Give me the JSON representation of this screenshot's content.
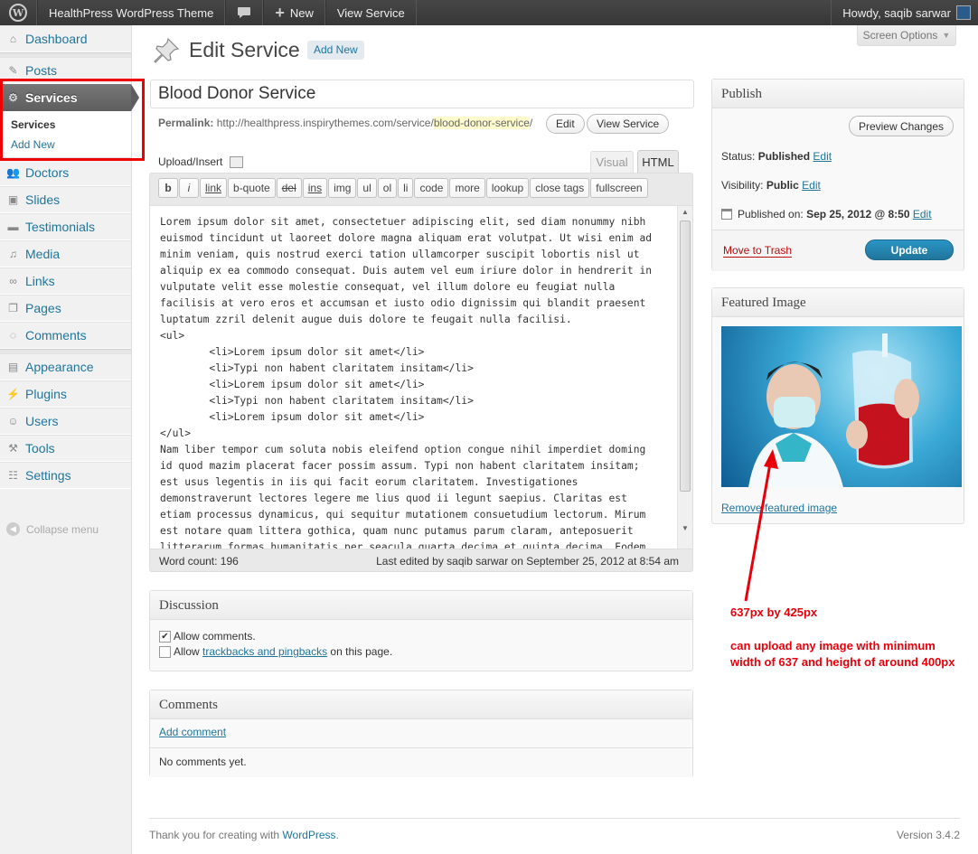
{
  "admin_bar": {
    "site_name": "HealthPress WordPress Theme",
    "comments_icon": "speech-bubble-icon",
    "new_label": "New",
    "view_label": "View Service",
    "howdy": "Howdy, saqib sarwar"
  },
  "sidebar": {
    "items": [
      {
        "label": "Dashboard",
        "icon": "dashboard-icon"
      },
      {
        "label": "Posts",
        "icon": "pin-icon"
      },
      {
        "label": "Services",
        "icon": "gear-icon"
      },
      {
        "label": "Doctors",
        "icon": "users-icon"
      },
      {
        "label": "Slides",
        "icon": "image-icon"
      },
      {
        "label": "Testimonials",
        "icon": "comment-icon"
      },
      {
        "label": "Media",
        "icon": "media-icon"
      },
      {
        "label": "Links",
        "icon": "link-icon"
      },
      {
        "label": "Pages",
        "icon": "pages-icon"
      },
      {
        "label": "Comments",
        "icon": "comments-icon"
      },
      {
        "label": "Appearance",
        "icon": "appearance-icon"
      },
      {
        "label": "Plugins",
        "icon": "plugin-icon"
      },
      {
        "label": "Users",
        "icon": "users-icon"
      },
      {
        "label": "Tools",
        "icon": "tools-icon"
      },
      {
        "label": "Settings",
        "icon": "settings-icon"
      }
    ],
    "submenu": [
      "Services",
      "Add New"
    ],
    "collapse": "Collapse menu"
  },
  "header": {
    "title": "Edit Service",
    "add_new": "Add New",
    "screen_options": "Screen Options"
  },
  "post": {
    "title": "Blood Donor Service",
    "permalink_label": "Permalink:",
    "permalink_base": "http://healthpress.inspirythemes.com/service/",
    "permalink_slug": "blood-donor-service",
    "permalink_end": "/",
    "edit_btn": "Edit",
    "view_btn": "View Service"
  },
  "editor": {
    "upload_label": "Upload/Insert",
    "tab_visual": "Visual",
    "tab_html": "HTML",
    "quicktags": [
      "b",
      "i",
      "link",
      "b-quote",
      "del",
      "ins",
      "img",
      "ul",
      "ol",
      "li",
      "code",
      "more",
      "lookup",
      "close tags",
      "fullscreen"
    ],
    "content": "Lorem ipsum dolor sit amet, consectetuer adipiscing elit, sed diam nonummy nibh\neuismod tincidunt ut laoreet dolore magna aliquam erat volutpat. Ut wisi enim ad\nminim veniam, quis nostrud exerci tation ullamcorper suscipit lobortis nisl ut\naliquip ex ea commodo consequat. Duis autem vel eum iriure dolor in hendrerit in\nvulputate velit esse molestie consequat, vel illum dolore eu feugiat nulla\nfacilisis at vero eros et accumsan et iusto odio dignissim qui blandit praesent\nluptatum zzril delenit augue duis dolore te feugait nulla facilisi.\n<ul>\n        <li>Lorem ipsum dolor sit amet</li>\n        <li>Typi non habent claritatem insitam</li>\n        <li>Lorem ipsum dolor sit amet</li>\n        <li>Typi non habent claritatem insitam</li>\n        <li>Lorem ipsum dolor sit amet</li>\n</ul>\nNam liber tempor cum soluta nobis eleifend option congue nihil imperdiet doming\nid quod mazim placerat facer possim assum. Typi non habent claritatem insitam;\nest usus legentis in iis qui facit eorum claritatem. Investigationes\ndemonstraverunt lectores legere me lius quod ii legunt saepius. Claritas est\netiam processus dynamicus, qui sequitur mutationem consuetudium lectorum. Mirum\nest notare quam littera gothica, quam nunc putamus parum claram, anteposuerit\nlitterarum formas humanitatis per seacula quarta decima et quinta decima. Eodem",
    "word_count": "Word count: 196",
    "last_edited": "Last edited by saqib sarwar on September 25, 2012 at 8:54 am"
  },
  "discussion": {
    "title": "Discussion",
    "allow_comments": "Allow comments.",
    "allow_prefix": "Allow ",
    "trackbacks_link": "trackbacks and pingbacks",
    "allow_suffix": " on this page."
  },
  "comments": {
    "title": "Comments",
    "add_comment": "Add comment",
    "none": "No comments yet."
  },
  "publish": {
    "title": "Publish",
    "preview": "Preview Changes",
    "status_label": "Status:",
    "status_value": "Published",
    "visibility_label": "Visibility:",
    "visibility_value": "Public",
    "published_label": "Published on:",
    "published_value": "Sep 25, 2012 @ 8:50",
    "edit": "Edit",
    "trash": "Move to Trash",
    "update": "Update"
  },
  "featured": {
    "title": "Featured Image",
    "remove": "Remove featured image"
  },
  "annotation": {
    "line1": "637px by 425px",
    "line2": "can upload any image with minimum width of 637 and height of around 400px",
    "color": "#e8000b"
  },
  "footer": {
    "thanks": "Thank you for creating with ",
    "wp_link": "WordPress",
    "dot": ".",
    "version": "Version 3.4.2"
  }
}
